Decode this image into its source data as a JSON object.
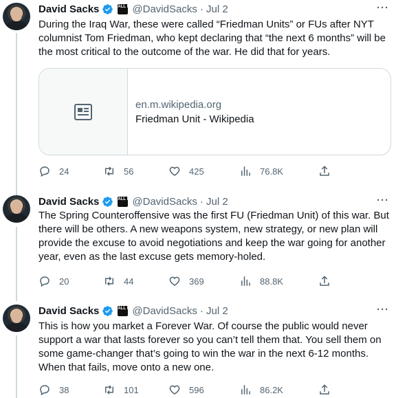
{
  "tweets": [
    {
      "name": "David Sacks",
      "badge_text": "ALL IN",
      "handle": "@DavidSacks",
      "date": "· Jul 2",
      "more": "···",
      "text": "During the Iraq War, these were called “Friedman Units” or FUs after NYT columnist Tom Friedman, who kept declaring that “the next 6 months” will be the most critical to the outcome of the war. He did that for years.",
      "card": {
        "domain": "en.m.wikipedia.org",
        "title": "Friedman Unit - Wikipedia",
        "icon": "article-icon"
      },
      "replies": "24",
      "retweets": "56",
      "likes": "425",
      "views": "76.8K"
    },
    {
      "name": "David Sacks",
      "badge_text": "ALL IN",
      "handle": "@DavidSacks",
      "date": "· Jul 2",
      "more": "···",
      "text": "The Spring Counteroffensive was the first FU (Friedman Unit) of this war. But there will be others. A new weapons system, new strategy, or new plan will provide the excuse to avoid negotiations and keep the war going for another year, even as the last excuse gets memory-holed.",
      "replies": "20",
      "retweets": "44",
      "likes": "369",
      "views": "88.8K"
    },
    {
      "name": "David Sacks",
      "badge_text": "ALL IN",
      "handle": "@DavidSacks",
      "date": "· Jul 2",
      "more": "···",
      "text": "This is how you market a Forever War. Of course the public would never support a war that lasts forever so you can’t tell them that. You sell them on some game-changer that’s going to win the war in the next 6-12 months. When that fails, move onto a new one.",
      "replies": "38",
      "retweets": "101",
      "likes": "596",
      "views": "86.2K"
    }
  ],
  "colors": {
    "verified": "#1d9bf0",
    "secondary_text": "#536471",
    "thread_line": "#cfd9de"
  }
}
